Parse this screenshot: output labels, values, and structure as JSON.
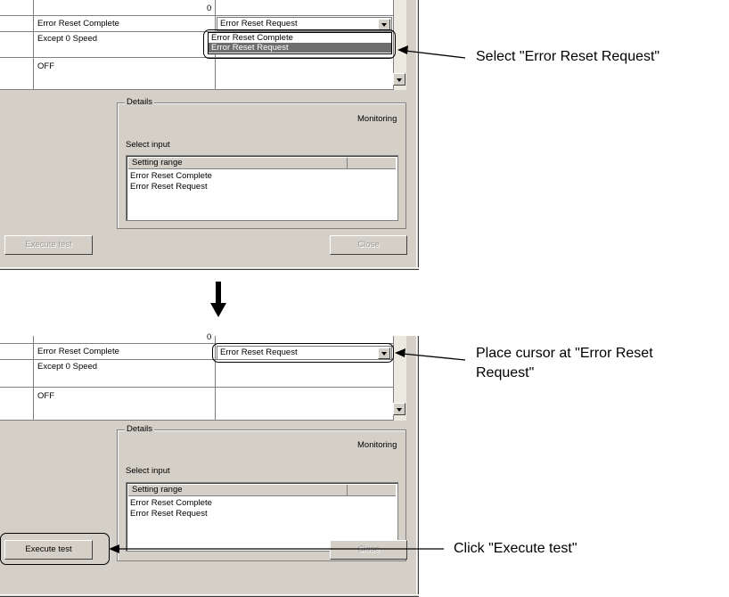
{
  "panel_top": {
    "rows": [
      {
        "label": "Error Reset Complete",
        "value": ""
      },
      {
        "label": "Except 0 Speed",
        "value": ""
      },
      {
        "label": "OFF",
        "value": ""
      }
    ],
    "header_fragment": "0",
    "combo_value": "Error Reset Request",
    "dropdown_options": [
      "Error Reset Complete",
      "Error Reset Request"
    ],
    "dropdown_selected": "Error Reset Request",
    "details": {
      "legend": "Details",
      "status": "Monitoring",
      "select_input": "Select input",
      "list_header": "Setting range",
      "list_items": [
        "Error Reset Complete",
        "Error Reset Request"
      ]
    },
    "execute_label": "Execute test",
    "close_label": "Close"
  },
  "panel_bottom": {
    "rows": [
      {
        "label": "Error Reset Complete",
        "value": ""
      },
      {
        "label": "Except 0 Speed",
        "value": ""
      },
      {
        "label": "OFF",
        "value": ""
      }
    ],
    "header_fragment": "0",
    "combo_value": "Error Reset Request",
    "details": {
      "legend": "Details",
      "status": "Monitoring",
      "select_input": "Select input",
      "list_header": "Setting range",
      "list_items": [
        "Error Reset Complete",
        "Error Reset Request"
      ]
    },
    "execute_label": "Execute test",
    "close_label": "Close"
  },
  "annotations": {
    "select_request": "Select \"Error Reset Request\"",
    "place_cursor_line1": "Place cursor at \"Error Reset",
    "place_cursor_line2": "Request\"",
    "click_execute": "Click \"Execute test\""
  },
  "colors": {
    "panel_bg": "#d4d0c8",
    "selection_bg": "#6e6e6e",
    "disabled_text": "#9c9a94"
  },
  "icons": [
    "dropdown-arrow-icon",
    "scroll-down-icon",
    "down-arrow-icon",
    "left-arrow-icon"
  ]
}
